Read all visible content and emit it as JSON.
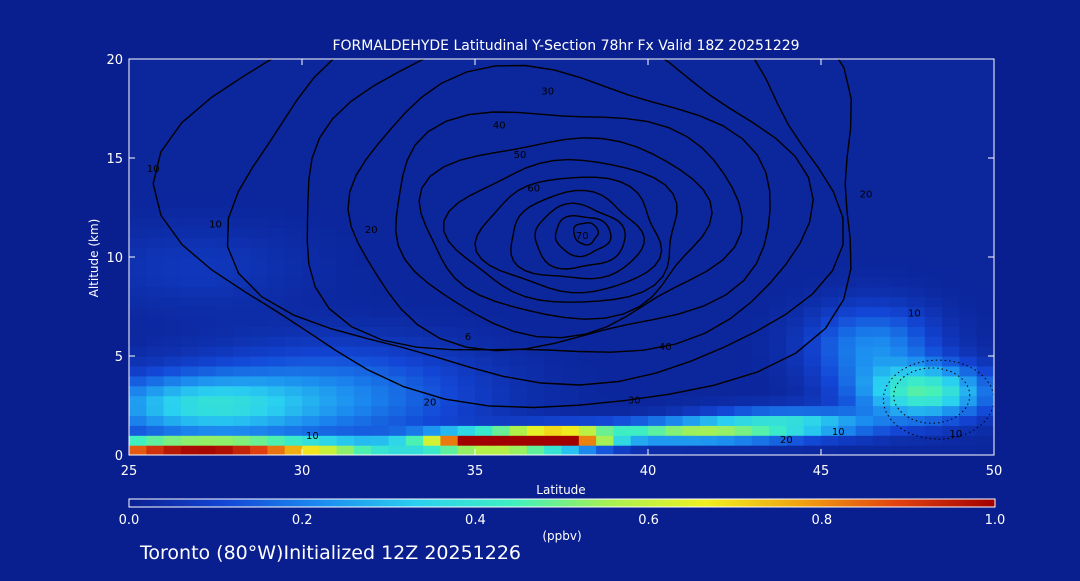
{
  "chart_data": {
    "type": "heatmap",
    "title": "FORMALDEHYDE Latitudinal Y-Section 78hr  Fx Valid 18Z 20251229",
    "xlabel": "Latitude",
    "ylabel": "Altitude (km)",
    "xlim": [
      25,
      50
    ],
    "ylim": [
      0,
      20
    ],
    "x_ticks": [
      "25",
      "30",
      "35",
      "40",
      "45",
      "50"
    ],
    "y_ticks": [
      "0",
      "5",
      "10",
      "15",
      "20"
    ],
    "colorbar": {
      "label": "(ppbv)",
      "range": [
        0.0,
        1.0
      ],
      "ticks": [
        "0.0",
        "0.2",
        "0.4",
        "0.6",
        "0.8",
        "1.0"
      ],
      "colors": [
        "#0a1f8f",
        "#1346d6",
        "#1c8cf0",
        "#2ad0f0",
        "#3ff0c0",
        "#a8f050",
        "#f0f020",
        "#f0a010",
        "#e04010",
        "#a00000"
      ]
    },
    "field_blobs": [
      {
        "lat": 27,
        "alt": 0.4,
        "sx": 5.0,
        "sy": 0.35,
        "v": 1.1
      },
      {
        "lat": 35.5,
        "alt": 0.7,
        "sx": 2.0,
        "sy": 0.5,
        "v": 1.05
      },
      {
        "lat": 37.5,
        "alt": 0.9,
        "sx": 1.5,
        "sy": 0.5,
        "v": 0.8
      },
      {
        "lat": 41,
        "alt": 1.2,
        "sx": 2.5,
        "sy": 0.5,
        "v": 0.45
      },
      {
        "lat": 44,
        "alt": 1.6,
        "sx": 2.5,
        "sy": 0.7,
        "v": 0.35
      },
      {
        "lat": 48,
        "alt": 3.2,
        "sx": 1.8,
        "sy": 1.3,
        "v": 0.42
      },
      {
        "lat": 46.5,
        "alt": 5.5,
        "sx": 1.8,
        "sy": 2.0,
        "v": 0.2
      },
      {
        "lat": 27,
        "alt": 2.5,
        "sx": 3.0,
        "sy": 1.5,
        "v": 0.3
      },
      {
        "lat": 31,
        "alt": 3.0,
        "sx": 4.0,
        "sy": 2.5,
        "v": 0.18
      },
      {
        "lat": 27,
        "alt": 9.5,
        "sx": 3.0,
        "sy": 2.0,
        "v": 0.05
      }
    ],
    "contour_centers": [
      {
        "lat": 38.2,
        "alt": 11.2,
        "rx": 0.35,
        "ry": 0.55,
        "label": "70"
      },
      {
        "lat": 38.1,
        "alt": 11.1,
        "rx": 0.8,
        "ry": 1.0,
        "label": ""
      },
      {
        "lat": 38.0,
        "alt": 11.0,
        "rx": 1.3,
        "ry": 1.6,
        "label": "60"
      },
      {
        "lat": 37.9,
        "alt": 11.0,
        "rx": 1.9,
        "ry": 2.2,
        "label": ""
      },
      {
        "lat": 37.8,
        "alt": 11.1,
        "rx": 2.6,
        "ry": 2.9,
        "label": "50"
      },
      {
        "lat": 37.7,
        "alt": 11.3,
        "rx": 3.3,
        "ry": 3.6,
        "label": ""
      },
      {
        "lat": 37.6,
        "alt": 11.6,
        "rx": 4.1,
        "ry": 4.5,
        "label": "40"
      },
      {
        "lat": 37.5,
        "alt": 12.0,
        "rx": 5.0,
        "ry": 5.6,
        "label": ""
      },
      {
        "lat": 37.3,
        "alt": 12.4,
        "rx": 6.1,
        "ry": 6.9,
        "label": "30"
      },
      {
        "lat": 37.1,
        "alt": 12.9,
        "rx": 7.3,
        "ry": 8.3,
        "label": ""
      },
      {
        "lat": 36.9,
        "alt": 13.3,
        "rx": 8.6,
        "ry": 9.8,
        "label": "20"
      },
      {
        "lat": 36.7,
        "alt": 13.7,
        "rx": 10.0,
        "ry": 11.3,
        "label": "10"
      }
    ],
    "contour_labels": [
      {
        "text": "70",
        "lat": 38.1,
        "alt": 10.9
      },
      {
        "text": "60",
        "lat": 36.7,
        "alt": 13.3
      },
      {
        "text": "50",
        "lat": 36.3,
        "alt": 15.0
      },
      {
        "text": "40",
        "lat": 35.7,
        "alt": 16.5
      },
      {
        "text": "30",
        "lat": 37.1,
        "alt": 18.2
      },
      {
        "text": "10",
        "lat": 27.5,
        "alt": 11.5
      },
      {
        "text": "10",
        "lat": 25.7,
        "alt": 14.3
      },
      {
        "text": "10",
        "lat": 30.3,
        "alt": 0.8
      },
      {
        "text": "20",
        "lat": 33.7,
        "alt": 2.5
      },
      {
        "text": "30",
        "lat": 39.6,
        "alt": 2.6
      },
      {
        "text": "40",
        "lat": 40.5,
        "alt": 5.3
      },
      {
        "text": "20",
        "lat": 32.0,
        "alt": 11.2
      },
      {
        "text": "20",
        "lat": 44.0,
        "alt": 0.6
      },
      {
        "text": "10",
        "lat": 45.5,
        "alt": 1.0
      },
      {
        "text": "10",
        "lat": 47.7,
        "alt": 7.0
      },
      {
        "text": "10",
        "lat": 48.9,
        "alt": 0.9
      },
      {
        "text": "20",
        "lat": 46.3,
        "alt": 13.0
      },
      {
        "text": "6",
        "lat": 34.8,
        "alt": 5.8
      }
    ]
  },
  "footer": "Toronto (80°W)Initialized 12Z 20251226"
}
